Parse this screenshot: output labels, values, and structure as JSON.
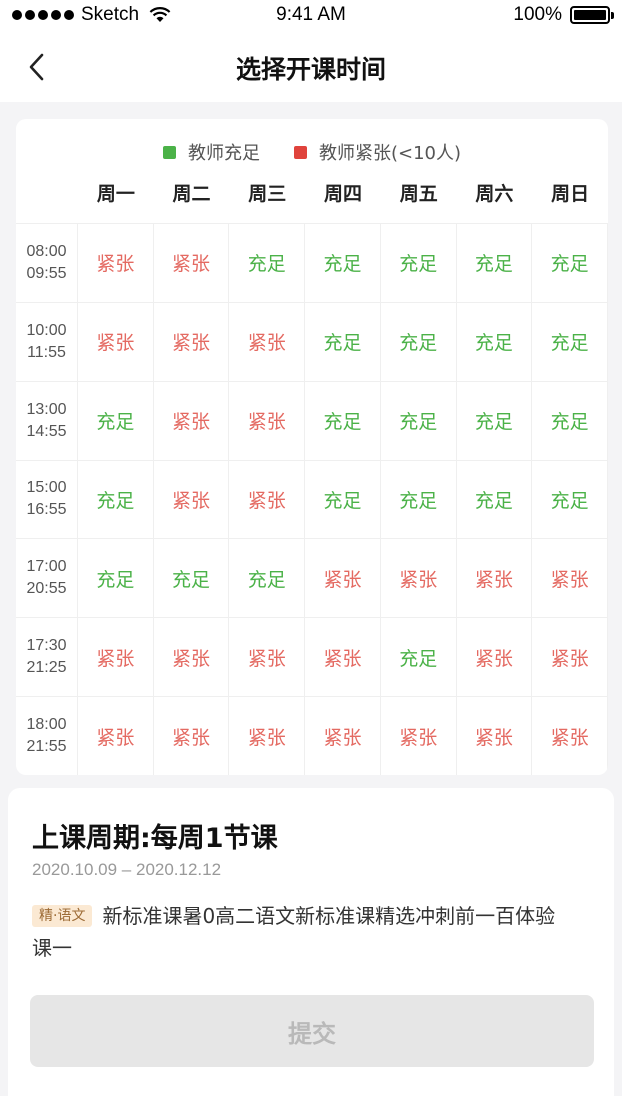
{
  "status_bar": {
    "carrier": "Sketch",
    "time": "9:41 AM",
    "battery": "100%",
    "battery_level": 1.0
  },
  "nav": {
    "title": "选择开课时间",
    "back_icon": "chevron-left-icon"
  },
  "legend": {
    "ok_label": "教师充足",
    "tight_label": "教师紧张(<10人)",
    "ok_color": "#4bb248",
    "tight_color": "#e0433c"
  },
  "days": [
    "周一",
    "周二",
    "周三",
    "周四",
    "周五",
    "周六",
    "周日"
  ],
  "slots": [
    {
      "start": "08:00",
      "end": "09:55",
      "status": [
        "紧张",
        "紧张",
        "充足",
        "充足",
        "充足",
        "充足",
        "充足"
      ]
    },
    {
      "start": "10:00",
      "end": "11:55",
      "status": [
        "紧张",
        "紧张",
        "紧张",
        "充足",
        "充足",
        "充足",
        "充足"
      ]
    },
    {
      "start": "13:00",
      "end": "14:55",
      "status": [
        "充足",
        "紧张",
        "紧张",
        "充足",
        "充足",
        "充足",
        "充足"
      ]
    },
    {
      "start": "15:00",
      "end": "16:55",
      "status": [
        "充足",
        "紧张",
        "紧张",
        "充足",
        "充足",
        "充足",
        "充足"
      ]
    },
    {
      "start": "17:00",
      "end": "20:55",
      "status": [
        "充足",
        "充足",
        "充足",
        "紧张",
        "紧张",
        "紧张",
        "紧张"
      ]
    },
    {
      "start": "17:30",
      "end": "21:25",
      "status": [
        "紧张",
        "紧张",
        "紧张",
        "紧张",
        "充足",
        "紧张",
        "紧张"
      ]
    },
    {
      "start": "18:00",
      "end": "21:55",
      "status": [
        "紧张",
        "紧张",
        "紧张",
        "紧张",
        "紧张",
        "紧张",
        "紧张"
      ]
    }
  ],
  "course": {
    "period_title": "上课周期:每周1节课",
    "date_range": "2020.10.09 – 2020.12.12",
    "badge": "精·语文",
    "name": "新标准课暑0高二语文新标准课精选冲刺前一百体验课一"
  },
  "submit_label": "提交"
}
